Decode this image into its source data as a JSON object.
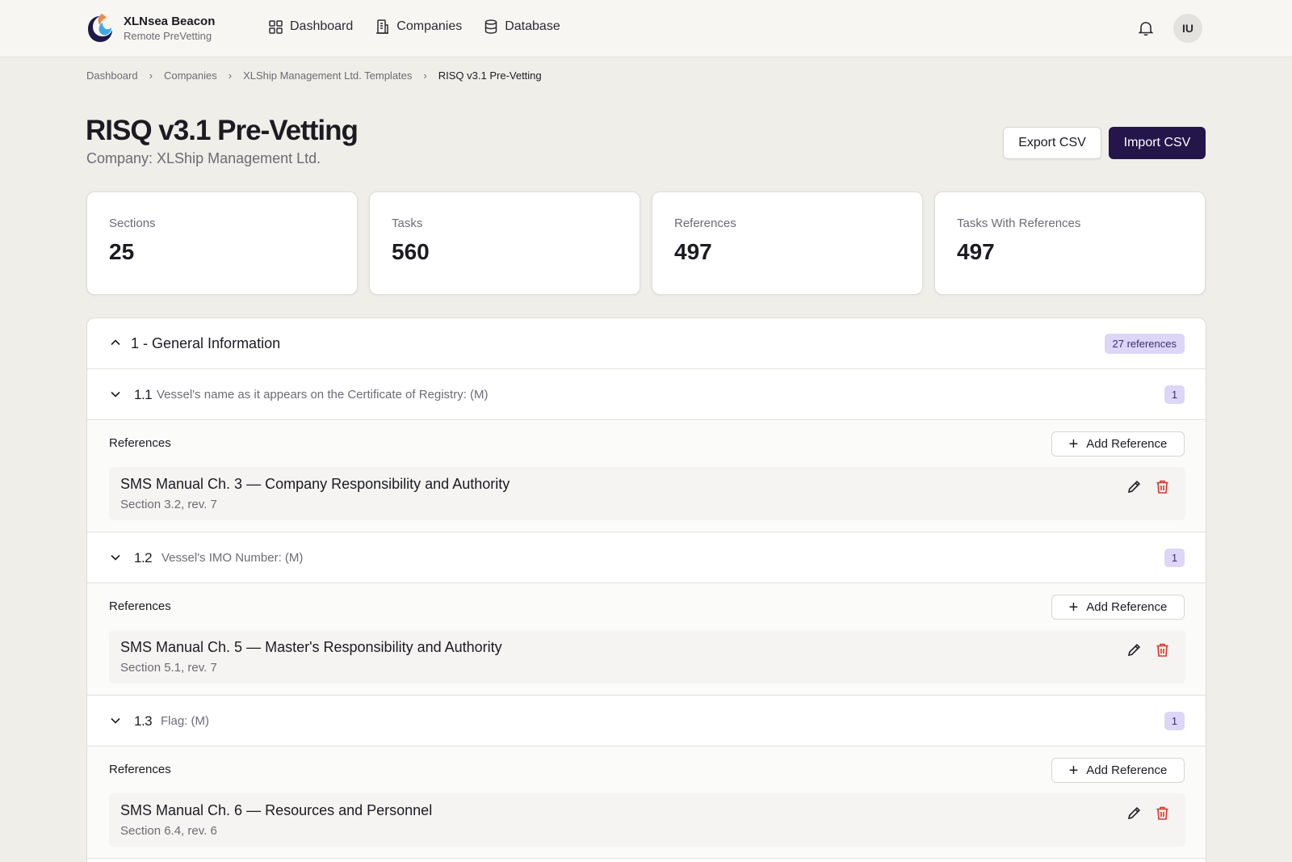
{
  "app": {
    "name": "XLNsea Beacon",
    "subtitle": "Remote PreVetting"
  },
  "nav": [
    {
      "label": "Dashboard",
      "icon": "dashboard-grid-icon"
    },
    {
      "label": "Companies",
      "icon": "building-icon"
    },
    {
      "label": "Database",
      "icon": "database-icon"
    }
  ],
  "user": {
    "initials": "IU"
  },
  "breadcrumb": [
    "Dashboard",
    "Companies",
    "XLShip Management Ltd. Templates",
    "RISQ v3.1 Pre-Vetting"
  ],
  "page": {
    "title": "RISQ v3.1 Pre-Vetting",
    "subtitle": "Company: XLShip Management Ltd.",
    "export_label": "Export CSV",
    "import_label": "Import CSV"
  },
  "stats": [
    {
      "label": "Sections",
      "value": "25"
    },
    {
      "label": "Tasks",
      "value": "560"
    },
    {
      "label": "References",
      "value": "497"
    },
    {
      "label": "Tasks With References",
      "value": "497"
    }
  ],
  "section": {
    "title": "1 - General Information",
    "badge": "27 references",
    "tasks": [
      {
        "number": "1.1",
        "text": "Vessel's name as it appears on the Certificate of Registry: (M)",
        "count": "1",
        "refs_label": "References",
        "add_label": "Add Reference",
        "reference": {
          "title": "SMS Manual Ch. 3 — Company Responsibility and Authority",
          "meta": "Section 3.2, rev. 7"
        }
      },
      {
        "number": "1.2",
        "text": "Vessel's IMO Number: (M)",
        "count": "1",
        "refs_label": "References",
        "add_label": "Add Reference",
        "reference": {
          "title": "SMS Manual Ch. 5 — Master's Responsibility and Authority",
          "meta": "Section 5.1, rev. 7"
        }
      },
      {
        "number": "1.3",
        "text": "Flag: (M)",
        "count": "1",
        "refs_label": "References",
        "add_label": "Add Reference",
        "reference": {
          "title": "SMS Manual Ch. 6 — Resources and Personnel",
          "meta": "Section 6.4, rev. 6"
        }
      }
    ]
  },
  "colors": {
    "accent": "#24164a",
    "pill": "#ddd6f7",
    "danger": "#d9342b",
    "background": "#efeee9"
  }
}
